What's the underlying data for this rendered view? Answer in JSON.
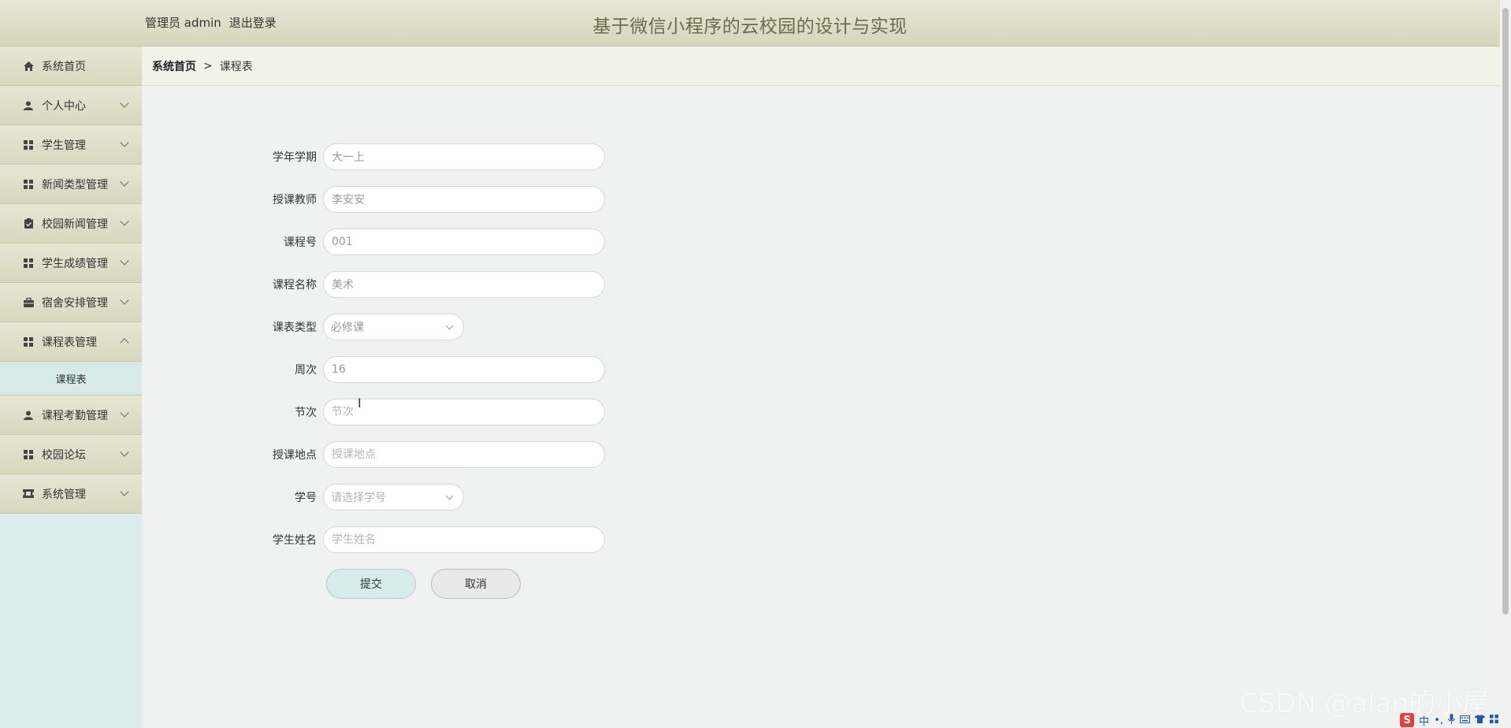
{
  "header": {
    "user_label": "管理员 admin",
    "logout_label": "退出登录",
    "title": "基于微信小程序的云校园的设计与实现"
  },
  "sidebar": {
    "items": [
      {
        "label": "系统首页",
        "icon": "home-icon"
      },
      {
        "label": "个人中心",
        "icon": "user-icon"
      },
      {
        "label": "学生管理",
        "icon": "grid-icon"
      },
      {
        "label": "新闻类型管理",
        "icon": "grid-icon"
      },
      {
        "label": "校园新闻管理",
        "icon": "clipboard-icon"
      },
      {
        "label": "学生成绩管理",
        "icon": "grid-icon"
      },
      {
        "label": "宿舍安排管理",
        "icon": "briefcase-icon"
      },
      {
        "label": "课程表管理",
        "icon": "grid-icon"
      },
      {
        "label": "课程考勤管理",
        "icon": "user-icon"
      },
      {
        "label": "校园论坛",
        "icon": "grid-icon"
      },
      {
        "label": "系统管理",
        "icon": "ticket-icon"
      }
    ],
    "subitems": {
      "course_table": "课程表"
    }
  },
  "breadcrumb": {
    "home": "系统首页",
    "separator": ">",
    "current": "课程表"
  },
  "form": {
    "semester": {
      "label": "学年学期",
      "value": "大一上"
    },
    "teacher": {
      "label": "授课教师",
      "value": "李安安"
    },
    "course_no": {
      "label": "课程号",
      "value": "001"
    },
    "course_name": {
      "label": "课程名称",
      "value": "美术"
    },
    "course_type": {
      "label": "课表类型",
      "value": "必修课"
    },
    "week": {
      "label": "周次",
      "value": "16"
    },
    "section": {
      "label": "节次",
      "placeholder": "节次"
    },
    "location": {
      "label": "授课地点",
      "placeholder": "授课地点"
    },
    "student_no": {
      "label": "学号",
      "placeholder": "请选择学号"
    },
    "student_name": {
      "label": "学生姓名",
      "placeholder": "学生姓名"
    },
    "submit_label": "提交",
    "cancel_label": "取消"
  },
  "watermark": "CSDN @alan的小屋",
  "ime": {
    "mode": "中"
  }
}
